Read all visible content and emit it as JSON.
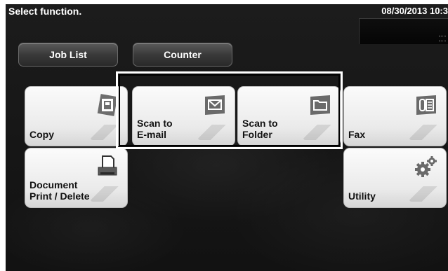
{
  "header": {
    "prompt": "Select function.",
    "datetime": "08/30/2013 10:3"
  },
  "tabs": {
    "job_list": "Job List",
    "counter": "Counter"
  },
  "functions": {
    "copy": "Copy",
    "scan_email": "Scan to\nE-mail",
    "scan_folder": "Scan to\nFolder",
    "fax": "Fax",
    "document": "Document\nPrint / Delete",
    "utility": "Utility"
  },
  "icons": {
    "copy": "copy-icon",
    "scan_email": "envelope-icon",
    "scan_folder": "folder-icon",
    "fax": "fax-icon",
    "document": "printer-icon",
    "utility": "gear-icon"
  }
}
